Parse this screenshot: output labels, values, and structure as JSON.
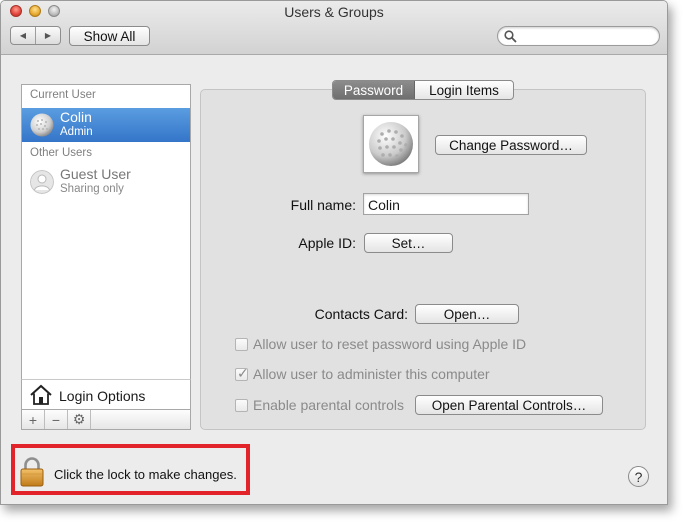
{
  "window": {
    "title": "Users & Groups",
    "show_all_label": "Show All",
    "search_placeholder": ""
  },
  "toolbar": {
    "back_icon": "back-arrow",
    "forward_icon": "forward-arrow"
  },
  "sidebar": {
    "current_user_header": "Current User",
    "current_user": {
      "name": "Colin",
      "role": "Admin"
    },
    "other_users_header": "Other Users",
    "other_users": [
      {
        "name": "Guest User",
        "role": "Sharing only"
      }
    ],
    "login_options_label": "Login Options",
    "tools": {
      "add": "+",
      "remove": "−",
      "action": "⚙"
    }
  },
  "tabs": [
    {
      "label": "Password",
      "active": true
    },
    {
      "label": "Login Items",
      "active": false
    }
  ],
  "password_pane": {
    "change_password_label": "Change Password…",
    "full_name_label": "Full name:",
    "full_name_value": "Colin",
    "apple_id_label": "Apple ID:",
    "apple_id_button": "Set…",
    "contacts_card_label": "Contacts Card:",
    "contacts_card_button": "Open…",
    "checkboxes": [
      {
        "label": "Allow user to reset password using Apple ID",
        "checked": false
      },
      {
        "label": "Allow user to administer this computer",
        "checked": true
      },
      {
        "label": "Enable parental controls",
        "checked": false
      }
    ],
    "parental_controls_button": "Open Parental Controls…"
  },
  "footer": {
    "lock_text": "Click the lock to make changes.",
    "help_label": "?"
  },
  "colors": {
    "selection": "#3a7ccd",
    "highlight_box": "#e3232a",
    "window_bg": "#ececec"
  }
}
